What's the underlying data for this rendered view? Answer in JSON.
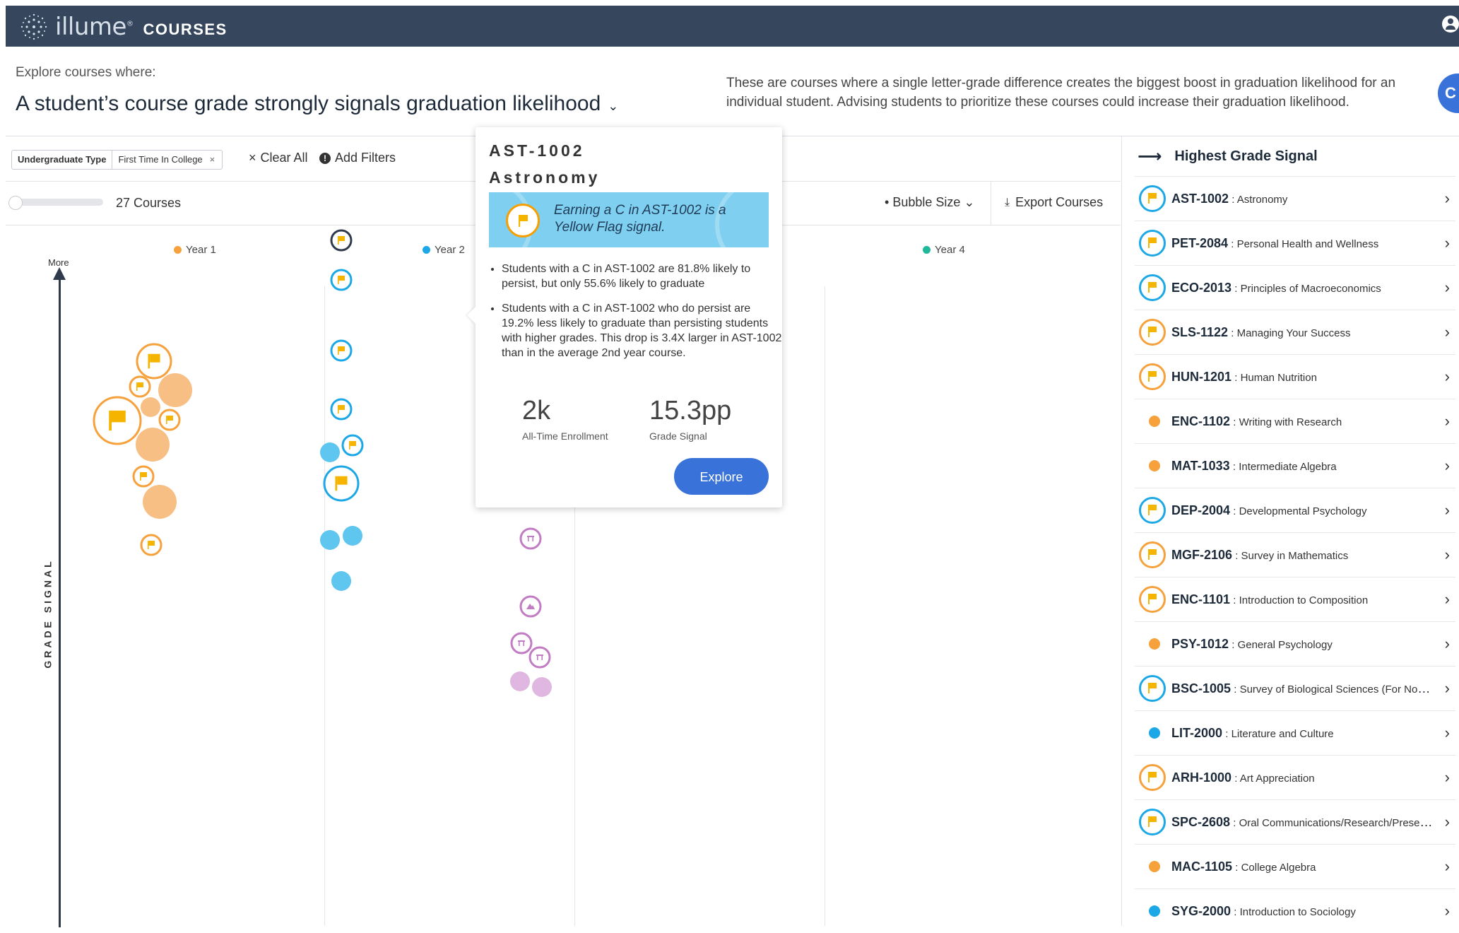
{
  "topbar": {
    "brand": "illume",
    "brand_mark": "®",
    "product": "COURSES"
  },
  "header": {
    "explore_label": "Explore courses where:",
    "headline": "A student’s course grade strongly signals graduation likelihood",
    "description": "These are courses where a single letter-grade difference creates the biggest boost in graduation likelihood for an individual student. Advising students to prioritize these courses could increase their graduation likelihood.",
    "fab_label": "C"
  },
  "filters": {
    "chip_key": "Undergraduate Type",
    "chip_value": "First Time In College",
    "chip_remove": "×",
    "clear_all": "Clear All",
    "clear_icon": "×",
    "add_filters": "Add Filters",
    "add_icon": "!"
  },
  "toolbar": {
    "count": "27 Courses",
    "bubble_size": "Bubble Size",
    "bubble_chevron": "⌄",
    "export": "Export Courses",
    "export_icon": "⤓"
  },
  "axis": {
    "more": "More",
    "title": "GRADE SIGNAL"
  },
  "years": [
    {
      "label": "Year 1",
      "color": "#f6a13b"
    },
    {
      "label": "Year 2",
      "color": "#1ca8e6"
    },
    {
      "label": "Year 4",
      "color": "#1fb89a"
    }
  ],
  "colors": {
    "year1": "#f6a13b",
    "year1_light": "#f8bf84",
    "year2": "#1ca8e6",
    "year2_light": "#5fc6f0",
    "year4": "#c17cc3",
    "year4_light": "#dfb7e0",
    "flag": "#f5b400",
    "accent": "#3972d8",
    "topbar": "#36465c"
  },
  "bubbles": [
    {
      "year": 1,
      "kind": "flag",
      "size": "medium",
      "icon": "flag-icon"
    },
    {
      "year": 1,
      "kind": "flag",
      "size": "small",
      "icon": "flag-icon"
    },
    {
      "year": 1,
      "kind": "fill",
      "size": "medium"
    },
    {
      "year": 1,
      "kind": "fill",
      "size": "small"
    },
    {
      "year": 1,
      "kind": "flag",
      "size": "large",
      "icon": "flag-icon"
    },
    {
      "year": 1,
      "kind": "flag",
      "size": "small",
      "icon": "flag-icon"
    },
    {
      "year": 1,
      "kind": "fill",
      "size": "medium"
    },
    {
      "year": 1,
      "kind": "flag",
      "size": "small",
      "icon": "flag-icon"
    },
    {
      "year": 1,
      "kind": "fill",
      "size": "medium"
    },
    {
      "year": 1,
      "kind": "flag",
      "size": "small",
      "icon": "flag-icon"
    },
    {
      "year": 2,
      "kind": "flag",
      "size": "small",
      "icon": "flag-icon",
      "selected": true
    },
    {
      "year": 2,
      "kind": "flag",
      "size": "small",
      "icon": "flag-icon"
    },
    {
      "year": 2,
      "kind": "flag",
      "size": "small",
      "icon": "flag-icon"
    },
    {
      "year": 2,
      "kind": "flag",
      "size": "small",
      "icon": "flag-icon"
    },
    {
      "year": 2,
      "kind": "fill",
      "size": "small"
    },
    {
      "year": 2,
      "kind": "flag",
      "size": "small",
      "icon": "flag-icon"
    },
    {
      "year": 2,
      "kind": "flag",
      "size": "medium",
      "icon": "flag-icon"
    },
    {
      "year": 2,
      "kind": "fill",
      "size": "small"
    },
    {
      "year": 2,
      "kind": "fill",
      "size": "small"
    },
    {
      "year": 2,
      "kind": "fill",
      "size": "small"
    },
    {
      "year": 4,
      "kind": "flag",
      "size": "small",
      "icon": "hurdle-icon"
    },
    {
      "year": 4,
      "kind": "flag",
      "size": "small",
      "icon": "mountain-icon"
    },
    {
      "year": 4,
      "kind": "flag",
      "size": "small",
      "icon": "hurdle-icon"
    },
    {
      "year": 4,
      "kind": "flag",
      "size": "small",
      "icon": "hurdle-icon"
    },
    {
      "year": 4,
      "kind": "fill",
      "size": "small"
    },
    {
      "year": 4,
      "kind": "fill",
      "size": "small"
    }
  ],
  "tooltip": {
    "code": "AST-1002",
    "name": "Astronomy",
    "banner": "Earning a C in AST-1002 is a Yellow Flag signal.",
    "bullets": [
      "Students with a C in AST-1002 are 81.8% likely to persist, but only 55.6% likely to graduate",
      "Students with a C in AST-1002 who do persist are 19.2% less likely to graduate than persisting students with higher grades. This drop is 3.4X larger in AST-1002 than in the average 2nd year course."
    ],
    "stats": [
      {
        "value": "2k",
        "label": "All-Time Enrollment"
      },
      {
        "value": "15.3pp",
        "label": "Grade Signal"
      }
    ],
    "explore": "Explore"
  },
  "panel": {
    "title": "Highest Grade Signal",
    "arrow": "⟶",
    "courses": [
      {
        "code": "AST-1002",
        "name": "Astronomy",
        "marker": "flag",
        "color": "#1ca8e6"
      },
      {
        "code": "PET-2084",
        "name": "Personal Health and Wellness",
        "marker": "flag",
        "color": "#1ca8e6"
      },
      {
        "code": "ECO-2013",
        "name": "Principles of Macroeconomics",
        "marker": "flag",
        "color": "#1ca8e6"
      },
      {
        "code": "SLS-1122",
        "name": "Managing Your Success",
        "marker": "flag",
        "color": "#f6a13b"
      },
      {
        "code": "HUN-1201",
        "name": "Human Nutrition",
        "marker": "flag",
        "color": "#f6a13b"
      },
      {
        "code": "ENC-1102",
        "name": "Writing with Research",
        "marker": "dot",
        "color": "#f6a13b"
      },
      {
        "code": "MAT-1033",
        "name": "Intermediate Algebra",
        "marker": "dot",
        "color": "#f6a13b"
      },
      {
        "code": "DEP-2004",
        "name": "Developmental Psychology",
        "marker": "flag",
        "color": "#1ca8e6"
      },
      {
        "code": "MGF-2106",
        "name": "Survey in Mathematics",
        "marker": "flag",
        "color": "#f6a13b"
      },
      {
        "code": "ENC-1101",
        "name": "Introduction to Composition",
        "marker": "flag",
        "color": "#f6a13b"
      },
      {
        "code": "PSY-1012",
        "name": "General Psychology",
        "marker": "dot",
        "color": "#f6a13b"
      },
      {
        "code": "BSC-1005",
        "name": "Survey of Biological Sciences (For Non-S...",
        "marker": "flag",
        "color": "#1ca8e6"
      },
      {
        "code": "LIT-2000",
        "name": "Literature and Culture",
        "marker": "dot",
        "color": "#1ca8e6"
      },
      {
        "code": "ARH-1000",
        "name": "Art Appreciation",
        "marker": "flag",
        "color": "#f6a13b"
      },
      {
        "code": "SPC-2608",
        "name": "Oral Communications/Research/Present...",
        "marker": "flag",
        "color": "#1ca8e6"
      },
      {
        "code": "MAC-1105",
        "name": "College Algebra",
        "marker": "dot",
        "color": "#f6a13b"
      },
      {
        "code": "SYG-2000",
        "name": "Introduction to Sociology",
        "marker": "dot",
        "color": "#1ca8e6"
      }
    ],
    "row_chevron": "›"
  }
}
